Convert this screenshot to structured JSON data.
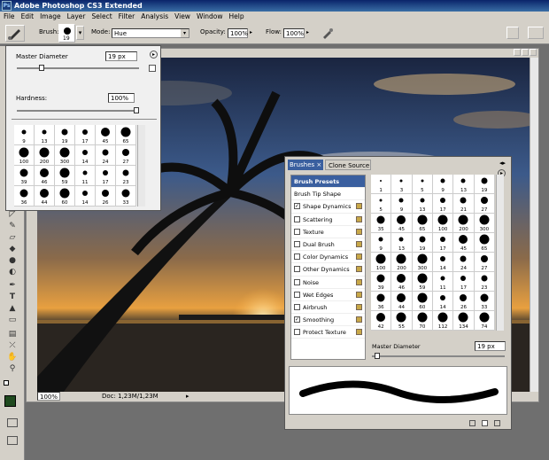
{
  "window": {
    "title": "Adobe Photoshop CS3 Extended",
    "icon": "ps-logo-icon",
    "icon_text": "Ps"
  },
  "menu": [
    "File",
    "Edit",
    "Image",
    "Layer",
    "Select",
    "Filter",
    "Analysis",
    "View",
    "Window",
    "Help"
  ],
  "options": {
    "brush_label": "Brush:",
    "brush_size": "19",
    "mode_label": "Mode:",
    "mode_value": "Hue",
    "opacity_label": "Opacity:",
    "opacity_value": "100%",
    "flow_label": "Flow:",
    "flow_value": "100%"
  },
  "picker": {
    "master_label": "Master Diameter",
    "master_value": "19 px",
    "master_level": 0.19,
    "hardness_label": "Hardness:",
    "hardness_value": "100%",
    "hardness_level": 1.0,
    "brushes": [
      "9",
      "13",
      "19",
      "17",
      "45",
      "65",
      "100",
      "200",
      "300",
      "14",
      "24",
      "27",
      "39",
      "46",
      "59",
      "11",
      "17",
      "23",
      "36",
      "44",
      "60",
      "14",
      "26",
      "33"
    ]
  },
  "document": {
    "zoom": "100%",
    "doc_info": "Doc: 1,23M/1,23M"
  },
  "brushes_panel": {
    "tabs": [
      "Brushes",
      "Clone Source"
    ],
    "tab_close": "×",
    "options": [
      {
        "label": "Brush Presets",
        "selected": true,
        "checkbox": false
      },
      {
        "label": "Brush Tip Shape",
        "checkbox": false
      },
      {
        "label": "Shape Dynamics",
        "checked": true
      },
      {
        "label": "Scattering",
        "checked": false
      },
      {
        "label": "Texture",
        "checked": false
      },
      {
        "label": "Dual Brush",
        "checked": false
      },
      {
        "label": "Color Dynamics",
        "checked": false
      },
      {
        "label": "Other Dynamics",
        "checked": false
      },
      {
        "label": "Noise",
        "checked": false
      },
      {
        "label": "Wet Edges",
        "checked": false
      },
      {
        "label": "Airbrush",
        "checked": false
      },
      {
        "label": "Smoothing",
        "checked": true
      },
      {
        "label": "Protect Texture",
        "checked": false
      }
    ],
    "brushes": [
      "1",
      "3",
      "5",
      "9",
      "13",
      "19",
      "5",
      "9",
      "13",
      "17",
      "21",
      "27",
      "35",
      "45",
      "65",
      "100",
      "200",
      "300",
      "9",
      "13",
      "19",
      "17",
      "45",
      "65",
      "100",
      "200",
      "300",
      "14",
      "24",
      "27",
      "39",
      "46",
      "59",
      "11",
      "17",
      "23",
      "36",
      "44",
      "60",
      "14",
      "26",
      "33",
      "42",
      "55",
      "70",
      "112",
      "134",
      "74"
    ],
    "master_label": "Master Diameter",
    "master_value": "19 px",
    "master_level": 0.02,
    "check_mark": "✓"
  },
  "colors": {
    "foreground": "#1f4a1f",
    "background": "#ffffff",
    "title_start": "#0a246a",
    "chrome": "#d4d0c8",
    "selected": "#3a5f9f"
  }
}
